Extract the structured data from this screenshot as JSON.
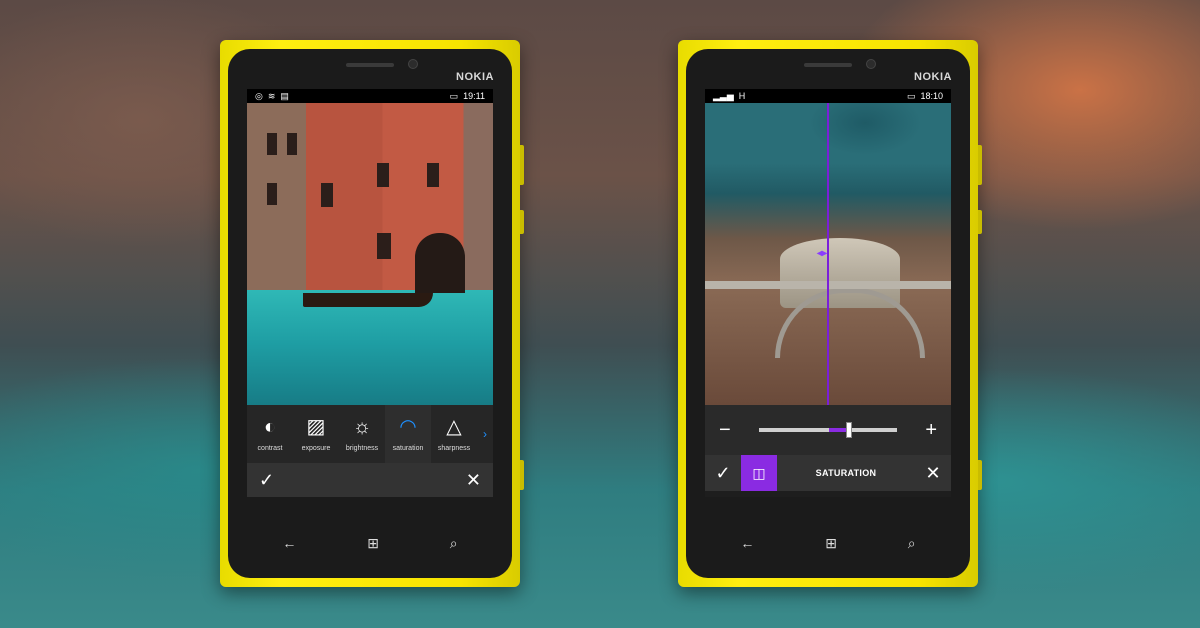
{
  "left_phone": {
    "brand": "NOKIA",
    "status": {
      "icons_left": [
        "◎",
        "≋",
        "▤"
      ],
      "battery": "▭",
      "time": "19:11"
    },
    "photo": "venice-canal-photo",
    "tools": [
      {
        "icon": "◐",
        "icon_name": "contrast-icon",
        "label": "contrast"
      },
      {
        "icon": "▨",
        "icon_name": "exposure-icon",
        "label": "exposure"
      },
      {
        "icon": "☼",
        "icon_name": "brightness-icon",
        "label": "brightness"
      },
      {
        "icon": "◠",
        "icon_name": "saturation-icon",
        "label": "saturation"
      },
      {
        "icon": "△",
        "icon_name": "sharpness-icon",
        "label": "sharpness"
      }
    ],
    "accept": "✓",
    "cancel": "✕",
    "nav": {
      "back": "←",
      "home": "⊞",
      "search": "⌕"
    }
  },
  "right_phone": {
    "brand": "NOKIA",
    "status": {
      "signal": "▂▃▅",
      "network": "H",
      "battery": "▭",
      "time": "18:10"
    },
    "photo": "hoover-dam-photo",
    "split_handle": "◂▸",
    "slider": {
      "minus": "−",
      "plus": "+",
      "value": 0.65
    },
    "accept": "✓",
    "compare_icon": "◫",
    "mode_title": "SATURATION",
    "cancel": "✕",
    "nav": {
      "back": "←",
      "home": "⊞",
      "search": "⌕"
    }
  },
  "colors": {
    "phone_yellow": "#f7e400",
    "accent_purple": "#8a2be2",
    "accent_blue": "#1e90ff"
  }
}
